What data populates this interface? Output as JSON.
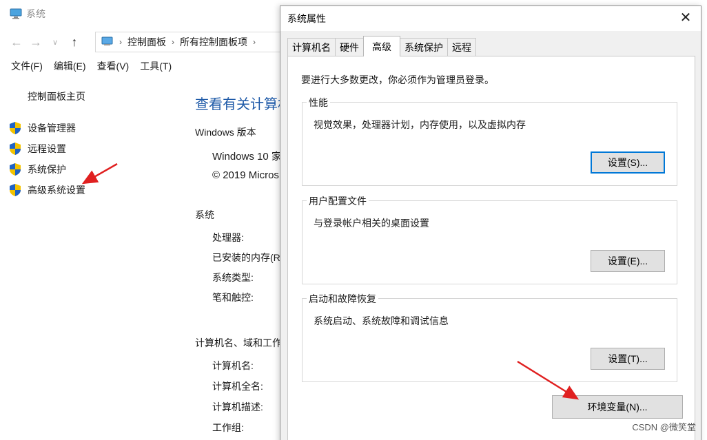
{
  "background_window": {
    "title": "系统",
    "breadcrumbs": [
      "控制面板",
      "所有控制面板项",
      "·"
    ],
    "menu": [
      "文件(F)",
      "编辑(E)",
      "查看(V)",
      "工具(T)"
    ],
    "home_link": "控制面板主页",
    "side_links": [
      {
        "label": "设备管理器",
        "icon": "uac-shield-icon"
      },
      {
        "label": "远程设置",
        "icon": "uac-shield-icon"
      },
      {
        "label": "系统保护",
        "icon": "uac-shield-icon"
      },
      {
        "label": "高级系统设置",
        "icon": "uac-shield-icon"
      }
    ],
    "main": {
      "title": "查看有关计算机",
      "windows_version_heading": "Windows 版本",
      "edition": "Windows 10 家",
      "copyright": "© 2019 Micros",
      "system_heading": "系统",
      "system_rows": [
        "处理器:",
        "已安装的内存(RA",
        "系统类型:",
        "笔和触控:"
      ],
      "computer_heading": "计算机名、域和工作",
      "computer_rows": [
        "计算机名:",
        "计算机全名:",
        "计算机描述:",
        "工作组:"
      ]
    }
  },
  "dialog": {
    "title": "系统属性",
    "tabs": [
      "计算机名",
      "硬件",
      "高级",
      "系统保护",
      "远程"
    ],
    "active_tab": "高级",
    "notice": "要进行大多数更改，你必须作为管理员登录。",
    "groups": [
      {
        "legend": "性能",
        "description": "视觉效果，处理器计划，内存使用，以及虚拟内存",
        "button": "设置(S)..."
      },
      {
        "legend": "用户配置文件",
        "description": "与登录帐户相关的桌面设置",
        "button": "设置(E)..."
      },
      {
        "legend": "启动和故障恢复",
        "description": "系统启动、系统故障和调试信息",
        "button": "设置(T)..."
      }
    ],
    "env_button": "环境变量(N)..."
  },
  "annotations": {
    "arrow_color": "#e02020"
  },
  "watermark": "CSDN @微笑堂"
}
